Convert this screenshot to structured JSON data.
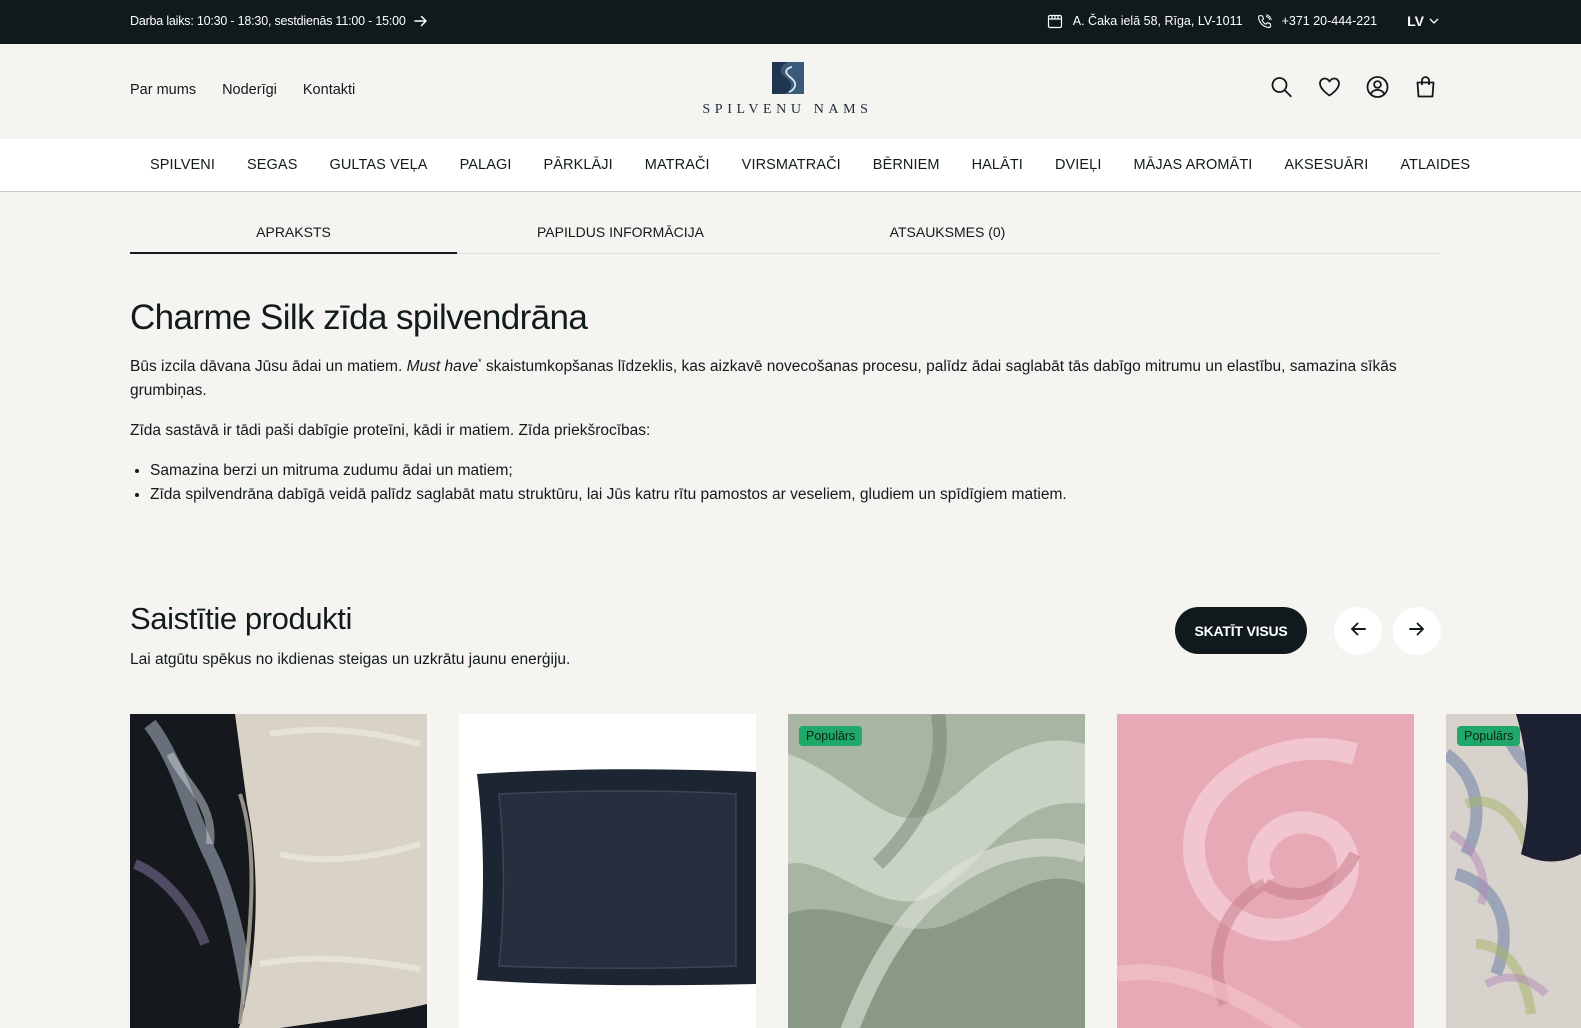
{
  "topbar": {
    "hours": "Darba laiks: 10:30 - 18:30, sestdienās 11:00 - 15:00",
    "address": "A. Čaka ielā 58, Rīga, LV-1011",
    "phone": "+371 20-444-221",
    "language": "LV"
  },
  "header": {
    "links": [
      "Par mums",
      "Noderīgi",
      "Kontakti"
    ],
    "logo_text": "SPILVENU NAMS"
  },
  "nav": {
    "items": [
      "SPILVENI",
      "SEGAS",
      "GULTAS VEĻA",
      "PALAGI",
      "PĀRKLĀJI",
      "MATRAČI",
      "VIRSMATRAČI",
      "BĒRNIEM",
      "HALĀTI",
      "DVIEĻI",
      "MĀJAS AROMĀTI",
      "AKSESUĀRI",
      "ATLAIDES"
    ]
  },
  "tabs": {
    "description": "APRAKSTS",
    "additional": "PAPILDUS INFORMĀCIJA",
    "reviews": "ATSAUKSMES (0)"
  },
  "description": {
    "title": "Charme Silk zīda spilvendrāna",
    "p1_start": "Būs izcila dāvana Jūsu ādai un matiem. ",
    "p1_em": "Must have",
    "p1_sup": "*",
    "p1_rest": " skaistumkopšanas līdzeklis, kas aizkavē novecošanas procesu, palīdz ādai saglabāt tās dabīgo mitrumu un elastību, samazina sīkās grumbiņas.",
    "p2": "Zīda sastāvā ir tādi paši dabīgie proteīni, kādi ir matiem. Zīda priekšrocības:",
    "bullets": [
      "Samazina berzi un mitruma zudumu ādai un matiem;",
      "Zīda spilvendrāna dabīgā veidā palīdz saglabāt matu struktūru, lai Jūs katru rītu pamostos ar veseliem, gludiem un spīdīgiem matiem."
    ]
  },
  "related": {
    "title": "Saistītie produkti",
    "subtitle": "Lai atgūtu spēkus no ikdienas steigas un uzkrātu jaunu enerģiju.",
    "view_all": "SKATĪT VISUS",
    "badge": "Populārs"
  },
  "colors": {
    "dark": "#101a1c",
    "background": "#f5f4f1",
    "badge": "#1fa868"
  }
}
